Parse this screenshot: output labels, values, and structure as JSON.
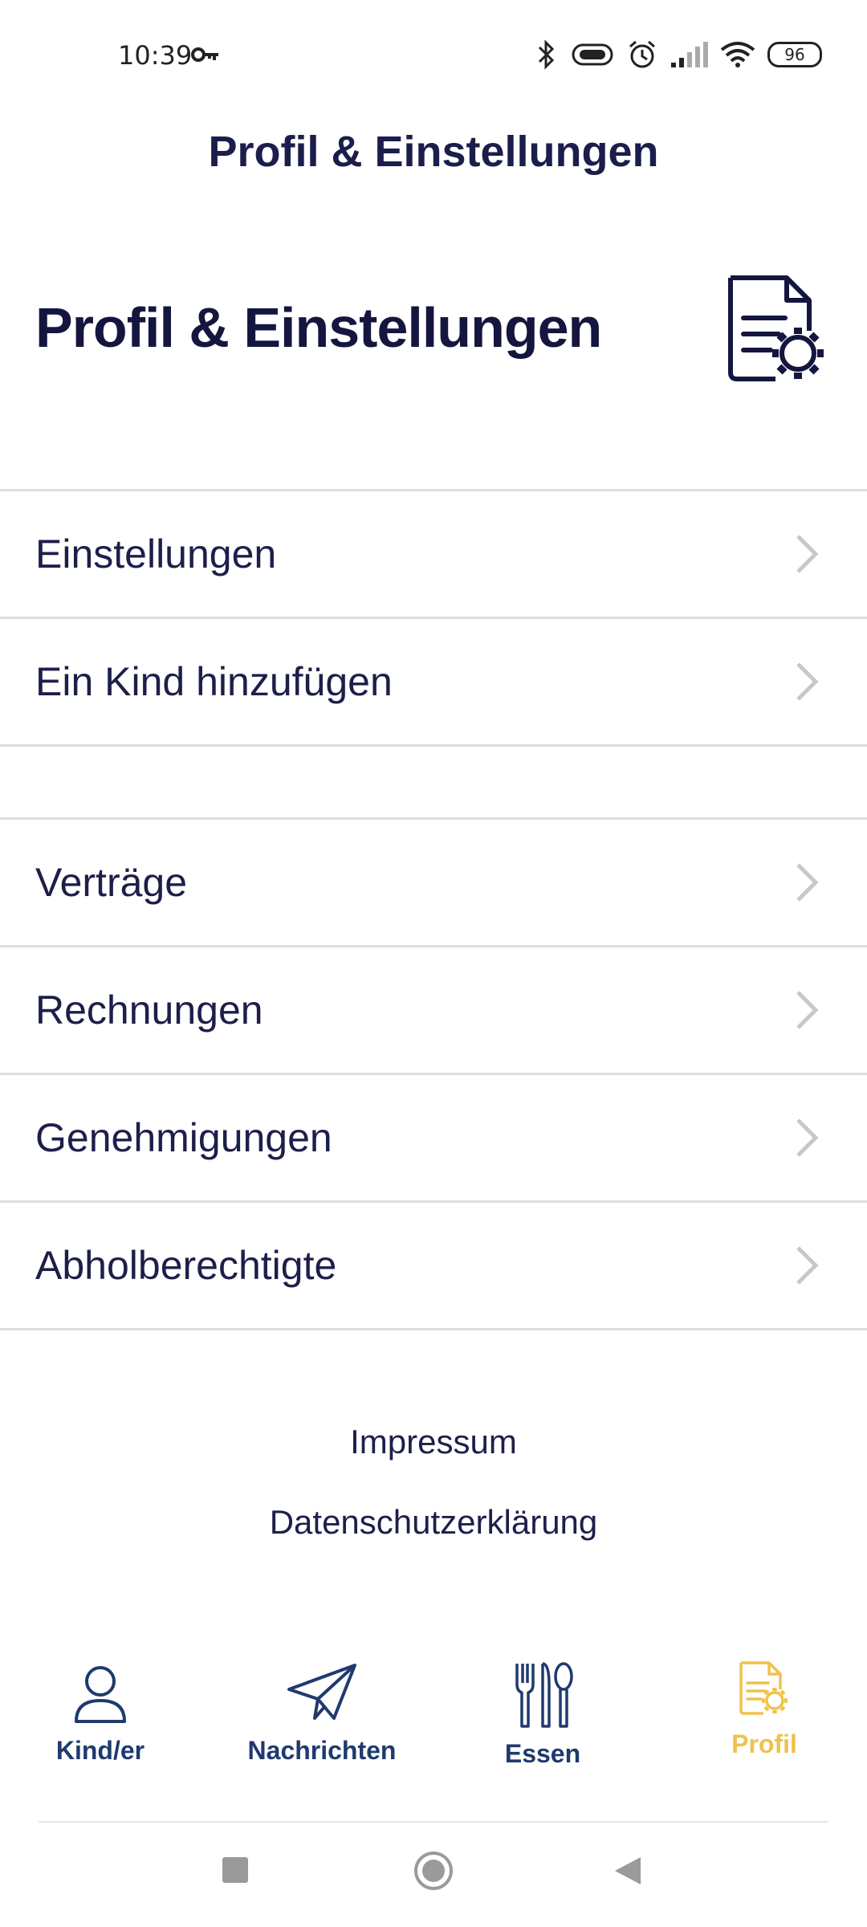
{
  "status_bar": {
    "time": "10:39",
    "battery": "96"
  },
  "app_bar": {
    "title": "Profil & Einstellungen"
  },
  "page": {
    "heading": "Profil & Einstellungen"
  },
  "menu_group_1": [
    {
      "label": "Einstellungen"
    },
    {
      "label": "Ein Kind hinzufügen"
    }
  ],
  "menu_group_2": [
    {
      "label": "Verträge"
    },
    {
      "label": "Rechnungen"
    },
    {
      "label": "Genehmigungen"
    },
    {
      "label": "Abholberechtigte"
    }
  ],
  "footer": {
    "impressum": "Impressum",
    "privacy": "Datenschutzerklärung"
  },
  "bottom_nav": {
    "items": [
      {
        "label": "Kind/er",
        "icon": "person-icon"
      },
      {
        "label": "Nachrichten",
        "icon": "paper-plane-icon"
      },
      {
        "label": "Essen",
        "icon": "cutlery-icon"
      },
      {
        "label": "Profil",
        "icon": "document-settings-icon",
        "active": true
      }
    ]
  },
  "colors": {
    "primary": "#1b1e4b",
    "nav": "#1f3a6e",
    "accent": "#efc24a",
    "divider": "#dedede"
  }
}
